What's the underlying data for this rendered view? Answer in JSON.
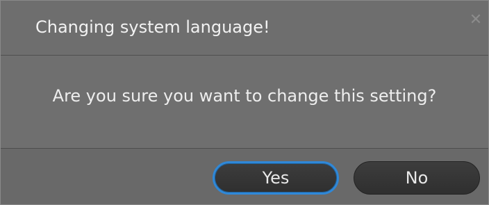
{
  "dialog": {
    "title": "Changing system language!",
    "close_icon": "close-icon",
    "message": "Are you sure you want to change this setting?",
    "buttons": {
      "yes_label": "Yes",
      "no_label": "No"
    }
  },
  "colors": {
    "background": "#6e6e6e",
    "button_bg": "#343434",
    "focus_ring": "#2f88d8",
    "text": "#f2f2f2"
  }
}
